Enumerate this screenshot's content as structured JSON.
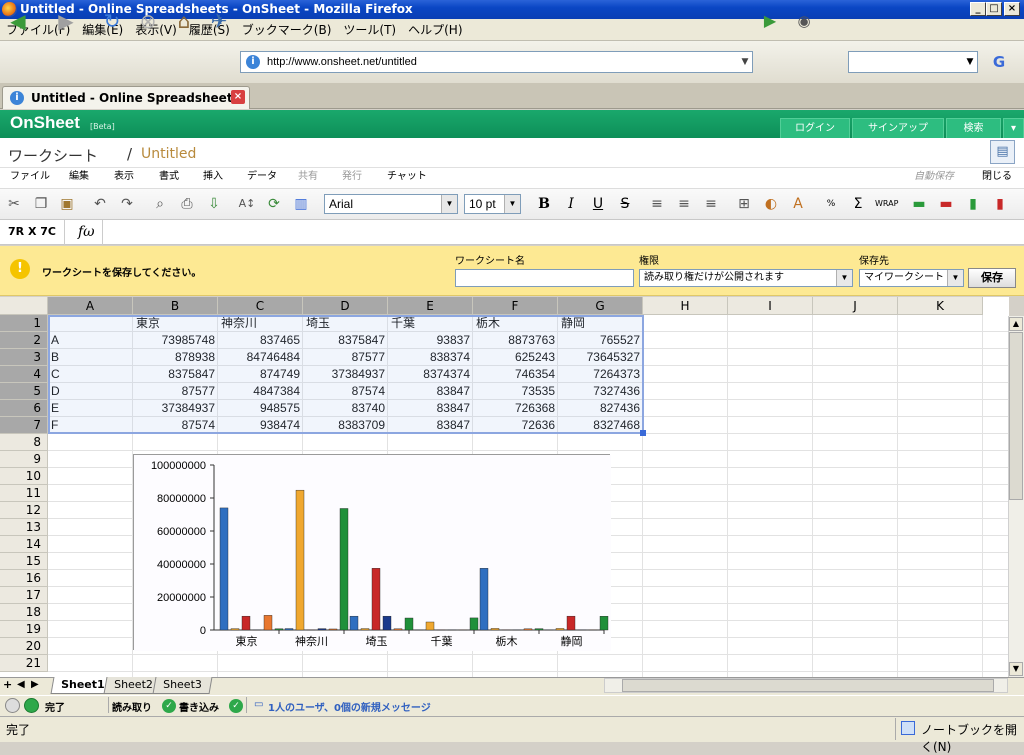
{
  "window": {
    "title": "Untitled - Online Spreadsheets - OnSheet - Mozilla Firefox"
  },
  "firefox_menu": [
    "ファイル(F)",
    "編集(E)",
    "表示(V)",
    "履歴(S)",
    "ブックマーク(B)",
    "ツール(T)",
    "ヘルプ(H)"
  ],
  "address": {
    "url": "http://www.onsheet.net/untitled"
  },
  "tab": {
    "title": "Untitled - Online Spreadsheet..."
  },
  "onsheet": {
    "logo": "OnSheet",
    "beta": "[Beta]",
    "topnav": [
      "ログイン",
      "サインアップ",
      "検索"
    ]
  },
  "doc": {
    "section": "ワークシート",
    "slash": "/",
    "name": "Untitled"
  },
  "app_menu": [
    "ファイル",
    "編集",
    "表示",
    "書式",
    "挿入",
    "データ",
    "共有",
    "発行",
    "チャット"
  ],
  "app_menu_right": {
    "autosave": "自動保存",
    "close": "閉じる"
  },
  "toolbar": {
    "font": "Arial",
    "size": "10 pt"
  },
  "formula": {
    "cellref": "7R X 7C",
    "fx": "fω"
  },
  "savebar": {
    "message": "ワークシートを保存してください。",
    "name_label": "ワークシート名",
    "name_value": "",
    "permission_label": "権限",
    "permission_value": "読み取り権だけが公開されます",
    "dest_label": "保存先",
    "dest_value": "マイワークシート",
    "save_button": "保存"
  },
  "sheet": {
    "columns": [
      "A",
      "B",
      "C",
      "D",
      "E",
      "F",
      "G",
      "H",
      "I",
      "J",
      "K"
    ],
    "rows": [
      "1",
      "2",
      "3",
      "4",
      "5",
      "6",
      "7",
      "8",
      "9",
      "10",
      "11",
      "12",
      "13",
      "14",
      "15",
      "16",
      "17",
      "18",
      "19",
      "20",
      "21"
    ],
    "header_row": [
      "",
      "東京",
      "神奈川",
      "埼玉",
      "千葉",
      "栃木",
      "静岡"
    ],
    "data": [
      [
        "A",
        "73985748",
        "837465",
        "8375847",
        "93837",
        "8873763",
        "765527"
      ],
      [
        "B",
        "878938",
        "84746484",
        "87577",
        "838374",
        "625243",
        "73645327"
      ],
      [
        "C",
        "8375847",
        "874749",
        "37384937",
        "8374374",
        "746354",
        "7264373"
      ],
      [
        "D",
        "87577",
        "4847384",
        "87574",
        "83847",
        "73535",
        "7327436"
      ],
      [
        "E",
        "37384937",
        "948575",
        "83740",
        "83847",
        "726368",
        "827436"
      ],
      [
        "F",
        "87574",
        "938474",
        "8383709",
        "83847",
        "72636",
        "8327468"
      ]
    ]
  },
  "chart_data": {
    "type": "bar",
    "categories": [
      "東京",
      "神奈川",
      "埼玉",
      "千葉",
      "栃木",
      "静岡"
    ],
    "series": [
      {
        "values": [
          73985748,
          878938,
          8375847,
          87577,
          37384937,
          87574
        ],
        "color": "#2f6fc0"
      },
      {
        "values": [
          837465,
          84746484,
          874749,
          4847384,
          948575,
          938474
        ],
        "color": "#f0a830"
      },
      {
        "values": [
          8375847,
          87577,
          37384937,
          87574,
          83740,
          8383709
        ],
        "color": "#c82828"
      },
      {
        "values": [
          93837,
          838374,
          8374374,
          83847,
          83847,
          83847
        ],
        "color": "#1a3a8c"
      },
      {
        "values": [
          8873763,
          625243,
          746354,
          73535,
          726368,
          72636
        ],
        "color": "#e87830"
      },
      {
        "values": [
          765527,
          73645327,
          7264373,
          7327436,
          827436,
          8327468
        ],
        "color": "#20903a"
      }
    ],
    "yticks": [
      "100000000",
      "80000000",
      "60000000",
      "40000000",
      "20000000",
      "0"
    ],
    "ylim": [
      0,
      100000000
    ],
    "grid": false,
    "legend": "none"
  },
  "sheets": [
    "Sheet1",
    "Sheet2",
    "Sheet3"
  ],
  "status": {
    "done": "完了",
    "read": "読み取り",
    "write": "書き込み",
    "users": "1人のユーザ、0個の新規メッセージ"
  },
  "ff_status": {
    "left": "完了",
    "notebook": "ノートブックを開く(N)"
  }
}
